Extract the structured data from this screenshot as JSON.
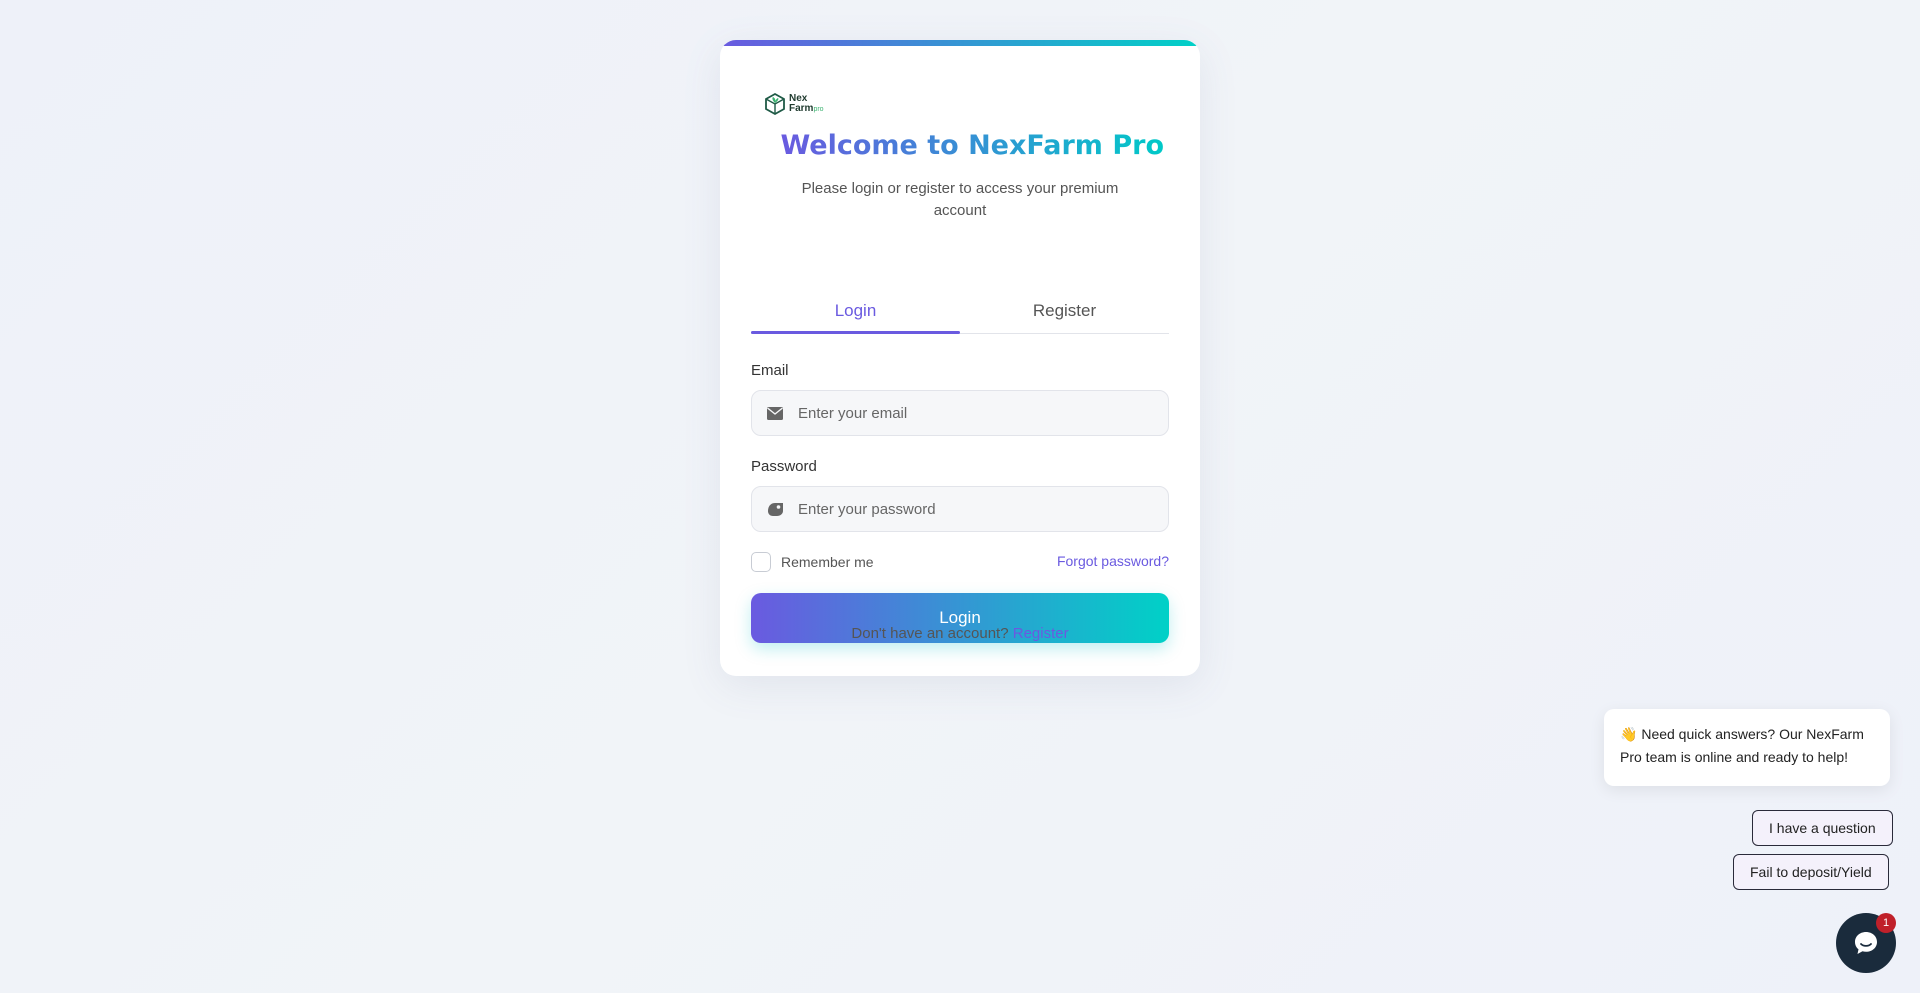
{
  "brand": {
    "logo_line1": "Nex",
    "logo_line2": "Farm",
    "logo_suffix": "pro",
    "logo_icon": "leaf-cube-icon"
  },
  "header": {
    "title": "Welcome to NexFarm Pro",
    "subtitle": "Please login or register to access your premium account"
  },
  "tabs": [
    {
      "label": "Login",
      "active": true
    },
    {
      "label": "Register",
      "active": false
    }
  ],
  "form": {
    "email_label": "Email",
    "email_placeholder": "Enter your email",
    "email_icon": "envelope-icon",
    "password_label": "Password",
    "password_placeholder": "Enter your password",
    "password_icon": "tag-icon",
    "remember_label": "Remember me",
    "forgot_label": "Forgot password?",
    "submit_label": "Login"
  },
  "footer": {
    "prompt": "Don't have an account?",
    "register_link": "Register"
  },
  "chat": {
    "greeting_emoji": "👋",
    "greeting": "Need quick answers? Our NexFarm Pro team is online and ready to help!",
    "quick_replies": [
      "I have a question",
      "Fail to deposit/Yield"
    ],
    "unread_count": "1",
    "launcher_icon": "chat-bubble-icon"
  },
  "colors": {
    "accent_start": "#6a5ae0",
    "accent_end": "#00d1c7",
    "badge": "#c0202a",
    "launcher": "#1a2b3c"
  }
}
